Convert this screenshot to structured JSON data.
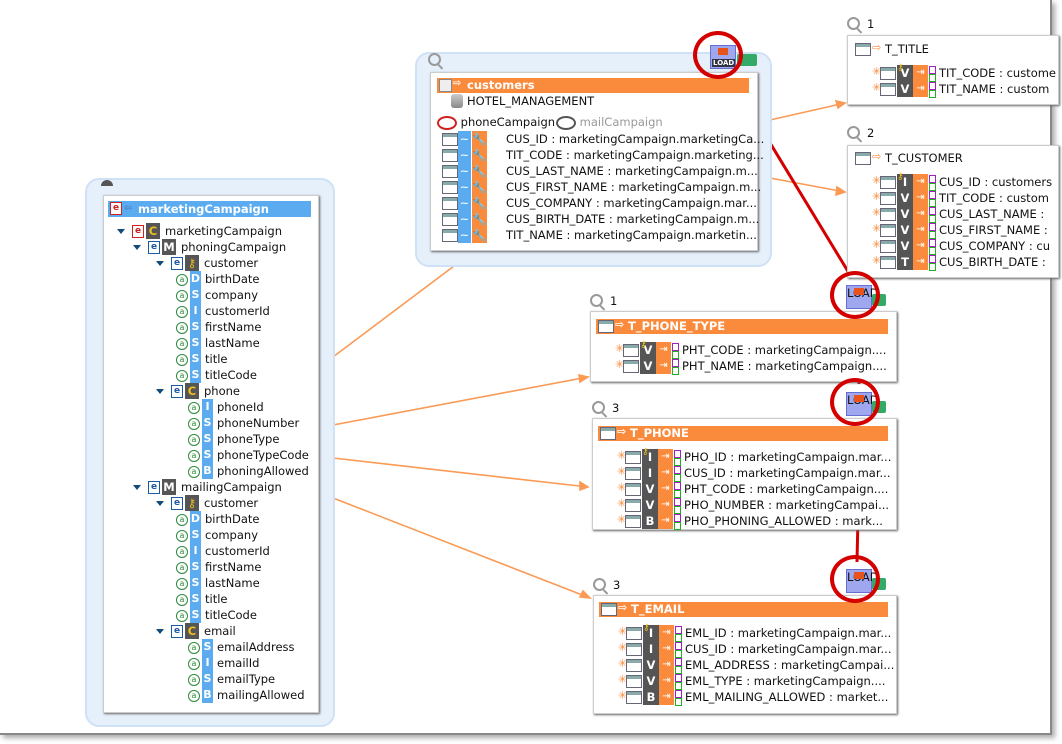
{
  "colors": {
    "accent": "#fb8b3c",
    "header_blue": "#5aabf0",
    "highlight": "#d40000"
  },
  "tree": {
    "title": "marketingCampaign",
    "items": [
      {
        "label": "marketingCampaign",
        "level": 0,
        "kind": "root",
        "expand": true
      },
      {
        "label": "phoningCampaign",
        "level": 1,
        "kind": "M",
        "expand": true
      },
      {
        "label": "customer",
        "level": 2,
        "kind": "key",
        "expand": true
      },
      {
        "label": "birthDate",
        "level": 3,
        "type": "D"
      },
      {
        "label": "company",
        "level": 3,
        "type": "S"
      },
      {
        "label": "customerId",
        "level": 3,
        "type": "I"
      },
      {
        "label": "firstName",
        "level": 3,
        "type": "S"
      },
      {
        "label": "lastName",
        "level": 3,
        "type": "S"
      },
      {
        "label": "title",
        "level": 3,
        "type": "S"
      },
      {
        "label": "titleCode",
        "level": 3,
        "type": "S"
      },
      {
        "label": "phone",
        "level": 2,
        "kind": "C",
        "expand": true
      },
      {
        "label": "phoneId",
        "level": 4,
        "type": "I"
      },
      {
        "label": "phoneNumber",
        "level": 4,
        "type": "S"
      },
      {
        "label": "phoneType",
        "level": 4,
        "type": "S"
      },
      {
        "label": "phoneTypeCode",
        "level": 4,
        "type": "S"
      },
      {
        "label": "phoningAllowed",
        "level": 4,
        "type": "B"
      },
      {
        "label": "mailingCampaign",
        "level": 1,
        "kind": "M",
        "expand": true
      },
      {
        "label": "customer",
        "level": 2,
        "kind": "key",
        "expand": true
      },
      {
        "label": "birthDate",
        "level": 3,
        "type": "D"
      },
      {
        "label": "company",
        "level": 3,
        "type": "S"
      },
      {
        "label": "customerId",
        "level": 3,
        "type": "I"
      },
      {
        "label": "firstName",
        "level": 3,
        "type": "S"
      },
      {
        "label": "lastName",
        "level": 3,
        "type": "S"
      },
      {
        "label": "title",
        "level": 3,
        "type": "S"
      },
      {
        "label": "titleCode",
        "level": 3,
        "type": "S"
      },
      {
        "label": "email",
        "level": 2,
        "kind": "C",
        "expand": true
      },
      {
        "label": "emailAddress",
        "level": 4,
        "type": "S"
      },
      {
        "label": "emailId",
        "level": 4,
        "type": "I"
      },
      {
        "label": "emailType",
        "level": 4,
        "type": "S"
      },
      {
        "label": "mailingAllowed",
        "level": 4,
        "type": "B"
      }
    ]
  },
  "customers": {
    "title": "customers",
    "datasource": "HOTEL_MANAGEMENT",
    "campaigns": [
      {
        "label": "phoneCampaign",
        "active": true
      },
      {
        "label": "mailCampaign",
        "active": false
      }
    ],
    "load_label": "LOAD",
    "rows": [
      "CUS_ID : marketingCampaign.marketingCa...",
      "TIT_CODE : marketingCampaign.marketing...",
      "CUS_LAST_NAME : marketingCampaign.m...",
      "CUS_FIRST_NAME : marketingCampaign.m...",
      "CUS_COMPANY : marketingCampaign.mar...",
      "CUS_BIRTH_DATE : marketingCampaign.m...",
      "TIT_NAME : marketingCampaign.marketin..."
    ]
  },
  "targets": [
    {
      "id": "t_title",
      "order": "1",
      "title": "T_TITLE",
      "orange": false,
      "rows": [
        {
          "t": "V",
          "key": true,
          "s": true,
          "text": "TIT_CODE : custome"
        },
        {
          "t": "V",
          "s": true,
          "text": "TIT_NAME : custom"
        }
      ]
    },
    {
      "id": "t_customer",
      "order": "2",
      "title": "T_CUSTOMER",
      "orange": false,
      "rows": [
        {
          "t": "I",
          "key": true,
          "s": true,
          "text": "CUS_ID : customers"
        },
        {
          "t": "V",
          "text": "TIT_CODE : custom"
        },
        {
          "t": "V",
          "s": true,
          "text": "CUS_LAST_NAME : "
        },
        {
          "t": "V",
          "text": "CUS_FIRST_NAME : "
        },
        {
          "t": "V",
          "text": "CUS_COMPANY : cu"
        },
        {
          "t": "T",
          "text": "CUS_BIRTH_DATE : "
        }
      ]
    },
    {
      "id": "t_phone_type",
      "order": "1",
      "title": "T_PHONE_TYPE",
      "orange": true,
      "load": true,
      "rows": [
        {
          "t": "V",
          "key": true,
          "s": true,
          "text": "PHT_CODE : marketingCampaign...."
        },
        {
          "t": "V",
          "s": true,
          "text": "PHT_NAME : marketingCampaign...."
        }
      ]
    },
    {
      "id": "t_phone",
      "order": "3",
      "title": "T_PHONE",
      "orange": true,
      "load": true,
      "rows": [
        {
          "t": "I",
          "key": true,
          "s": true,
          "text": "PHO_ID : marketingCampaign.mar..."
        },
        {
          "t": "I",
          "s": true,
          "text": "CUS_ID : marketingCampaign.mar..."
        },
        {
          "t": "V",
          "s": true,
          "text": "PHT_CODE : marketingCampaign...."
        },
        {
          "t": "V",
          "s": true,
          "text": "PHO_NUMBER : marketingCampai..."
        },
        {
          "t": "B",
          "text": "PHO_PHONING_ALLOWED : mark..."
        }
      ]
    },
    {
      "id": "t_email",
      "order": "3",
      "title": "T_EMAIL",
      "orange": true,
      "load": true,
      "rows": [
        {
          "t": "I",
          "key": true,
          "s": true,
          "text": "EML_ID : marketingCampaign.mar..."
        },
        {
          "t": "I",
          "s": true,
          "text": "CUS_ID : marketingCampaign.mar..."
        },
        {
          "t": "V",
          "s": true,
          "text": "EML_ADDRESS : marketingCampai..."
        },
        {
          "t": "V",
          "text": "EML_TYPE : marketingCampaign...."
        },
        {
          "t": "B",
          "text": "EML_MAILING_ALLOWED : market..."
        }
      ]
    }
  ]
}
